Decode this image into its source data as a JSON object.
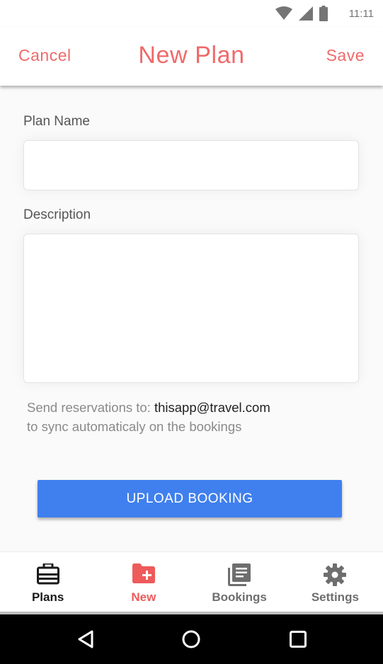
{
  "status_bar": {
    "time": "11:11",
    "icons": [
      "wifi-icon",
      "cellular-signal-icon",
      "battery-icon"
    ],
    "icon_color": "#757575"
  },
  "app_bar": {
    "cancel_label": "Cancel",
    "title": "New Plan",
    "save_label": "Save",
    "accent_color": "#f06a6a"
  },
  "form": {
    "plan_name_label": "Plan Name",
    "plan_name_value": "",
    "description_label": "Description",
    "description_value": ""
  },
  "sync_note": {
    "prefix": "Send reservations to: ",
    "email": "thisapp@travel.com",
    "suffix": "to sync automaticaly on the bookings"
  },
  "upload_button": {
    "label": "UPLOAD BOOKING",
    "color": "#4080ee"
  },
  "bottom_nav": {
    "items": [
      {
        "label": "Plans",
        "icon": "briefcase-icon",
        "active": true
      },
      {
        "label": "New",
        "icon": "folder-plus-icon",
        "highlight": true
      },
      {
        "label": "Bookings",
        "icon": "library-books-icon"
      },
      {
        "label": "Settings",
        "icon": "gear-icon"
      }
    ]
  },
  "system_nav": {
    "icons": [
      "back-icon",
      "home-icon",
      "recents-icon"
    ]
  }
}
